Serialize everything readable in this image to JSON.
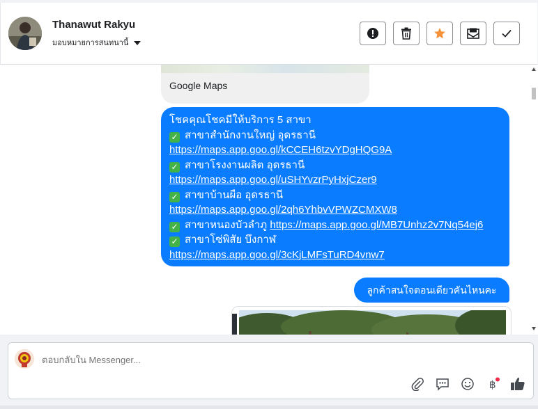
{
  "header": {
    "contact_name": "Thanawut Rakyu",
    "assign_label": "มอบหมายการสนทนานี้",
    "actions": [
      {
        "name": "report-button",
        "icon": "exclamation-circle-icon"
      },
      {
        "name": "delete-button",
        "icon": "trash-icon"
      },
      {
        "name": "star-button",
        "icon": "star-icon"
      },
      {
        "name": "mark-unread-button",
        "icon": "envelope-icon"
      },
      {
        "name": "mark-done-button",
        "icon": "checkmark-icon"
      }
    ],
    "star_color": "#f7923a"
  },
  "messages": {
    "map_card_title": "Google Maps",
    "branches_intro": "โชคคุณโชคมีให้บริการ 5 สาขา",
    "branches": [
      {
        "label": "สาขาสำนักงานใหญ่ อุดรธานี",
        "link": "https://maps.app.goo.gl/kCCEH6tzvYDgHQG9A"
      },
      {
        "label": "สาขาโรงงานผลิต อุดรธานี",
        "link": "https://maps.app.goo.gl/uSHYvzrPyHxjCzer9"
      },
      {
        "label": "สาขาบ้านผือ อุดรธานี",
        "link": "https://maps.app.goo.gl/2qh6YhbvVPWZCMXW8"
      },
      {
        "label": "สาขาหนองบัวลำภู",
        "link": "https://maps.app.goo.gl/MB7Unhz2v7Nq54ej6"
      },
      {
        "label": "สาขาโซ่พิสัย บึงกาฬ",
        "link": "https://maps.app.goo.gl/3cKjLMFsTuRD4vnw7"
      }
    ],
    "question": "ลูกค้าสนใจตอนเดียวคันไหนคะ"
  },
  "composer": {
    "placeholder": "ตอบกลับใน Messenger...",
    "tools": [
      "paperclip-icon",
      "saved-reply-icon",
      "emoji-icon",
      "baht-icon",
      "thumbs-up-icon"
    ],
    "notification_dot_color": "#f02849"
  },
  "colors": {
    "outgoing_bubble": "#0a7cff",
    "check_green": "#43b347"
  }
}
